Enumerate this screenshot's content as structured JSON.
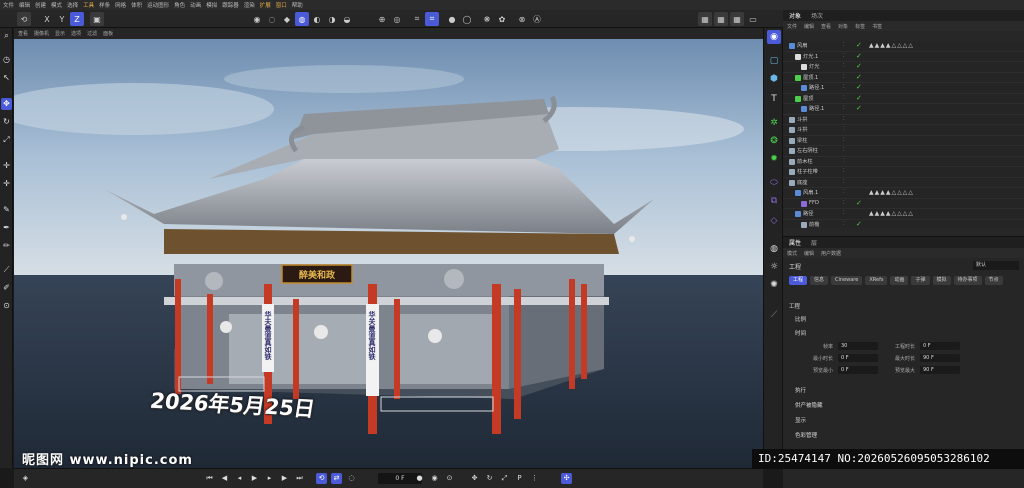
{
  "menubar": {
    "items": [
      "文件",
      "编辑",
      "创建",
      "模式",
      "选择",
      "工具",
      "样条",
      "网格",
      "体积",
      "运动图形",
      "角色",
      "动画",
      "模拟",
      "跟踪器",
      "渲染",
      "扩展",
      "窗口",
      "帮助"
    ]
  },
  "viewport": {
    "menu": [
      "查看",
      "摄像机",
      "显示",
      "选项",
      "过滤",
      "面板"
    ],
    "date_overlay": "2026年5月25日",
    "plaque_text": "醉美和政",
    "couplet_left": "华夫曼道真如铁",
    "couplet_right": "华关曼道真如铁"
  },
  "timeline": {
    "frame": "0 F"
  },
  "object_manager": {
    "tabs": [
      "对象",
      "场次"
    ],
    "menu": [
      "文件",
      "编辑",
      "查看",
      "对象",
      "标签",
      "书签"
    ],
    "rows": [
      {
        "name": "风扇",
        "indent": 0,
        "check": false,
        "tags": "▲▲▲▲△△△△"
      },
      {
        "name": "灯光.1",
        "indent": 1,
        "check": true,
        "tags": ""
      },
      {
        "name": "灯光",
        "indent": 2,
        "check": true,
        "tags": ""
      },
      {
        "name": "屋顶.1",
        "indent": 0,
        "check": true,
        "tags": ""
      },
      {
        "name": "路径.1",
        "indent": 1,
        "check": true,
        "tags": ""
      },
      {
        "name": "屋顶",
        "indent": 0,
        "check": true,
        "tags": ""
      },
      {
        "name": "路径.1",
        "indent": 1,
        "check": true,
        "tags": ""
      },
      {
        "name": "斗拱",
        "indent": 0,
        "check": false,
        "tags": ""
      },
      {
        "name": "斗拱",
        "indent": 0,
        "check": false,
        "tags": ""
      },
      {
        "name": "梁柱",
        "indent": 0,
        "check": false,
        "tags": ""
      },
      {
        "name": "左右阴柱",
        "indent": 0,
        "check": false,
        "tags": ""
      },
      {
        "name": "前木柱",
        "indent": 0,
        "check": false,
        "tags": ""
      },
      {
        "name": "柱子柱带",
        "indent": 0,
        "check": false,
        "tags": ""
      },
      {
        "name": "底座",
        "indent": 0,
        "check": false,
        "tags": ""
      },
      {
        "name": "风扇.1",
        "indent": 1,
        "check": false,
        "tags": "▲▲▲▲△△△△"
      },
      {
        "name": "FFD",
        "indent": 2,
        "check": true,
        "tags": ""
      },
      {
        "name": "路径",
        "indent": 1,
        "check": false,
        "tags": "▲▲▲▲△△△△"
      },
      {
        "name": "前檐",
        "indent": 2,
        "check": true,
        "tags": ""
      }
    ]
  },
  "attributes": {
    "tabs": [
      "属性",
      "层"
    ],
    "menu": [
      "模式",
      "编辑",
      "用户数据"
    ],
    "title": "工程",
    "preset": "默认",
    "buttons": [
      "工程",
      "信息",
      "Cineware",
      "XRefs",
      "动画",
      "子弹",
      "模拟",
      "待办事项",
      "节点"
    ],
    "section_title": "工程",
    "groups": [
      "比例",
      "时间",
      "执行",
      "供产被隐藏",
      "显示",
      "色彩管理"
    ],
    "fields": [
      {
        "label": "帧率",
        "value": "30"
      },
      {
        "label": "工程时长",
        "value": "0 F"
      },
      {
        "label": "最小时长",
        "value": "0 F"
      },
      {
        "label": "最大时长",
        "value": "90 F"
      },
      {
        "label": "预览最小",
        "value": "0 F"
      },
      {
        "label": "预览最大",
        "value": "90 F"
      }
    ]
  },
  "watermarks": {
    "left": "昵图网 www.nipic.com",
    "right": "ID:25474147 NO:20260526095053286102"
  },
  "colors": {
    "accent": "#4a5ad8",
    "check": "#4cd04c",
    "sky": "#8fb0cf",
    "ground": "#2e3b4c",
    "pillar": "#c53a25"
  }
}
